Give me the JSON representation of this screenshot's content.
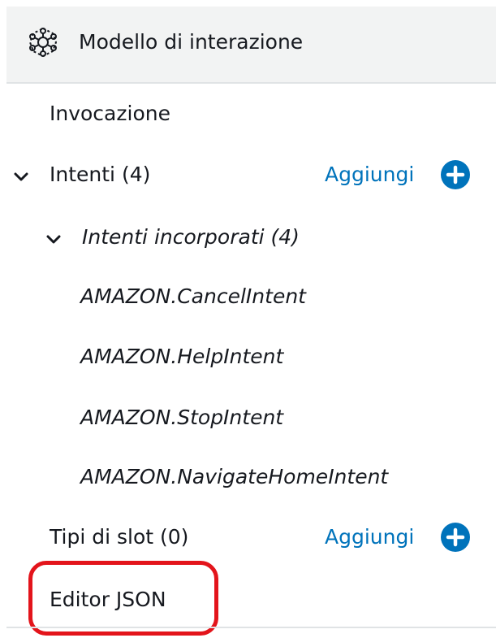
{
  "header": {
    "icon": "interaction-model-icon",
    "title": "Modello di interazione"
  },
  "nav": {
    "invocation": "Invocazione",
    "intents": {
      "label": "Intenti (4)",
      "expanded": true,
      "add_label": "Aggiungi"
    },
    "builtin_intents": {
      "label": "Intenti incorporati (4)",
      "expanded": true,
      "items": [
        "AMAZON.CancelIntent",
        "AMAZON.HelpIntent",
        "AMAZON.StopIntent",
        "AMAZON.NavigateHomeIntent"
      ]
    },
    "slot_types": {
      "label": "Tipi di slot (0)",
      "add_label": "Aggiungi"
    },
    "json_editor": "Editor JSON"
  },
  "colors": {
    "link": "#0073bb",
    "add_button": "#0073bb",
    "highlight": "#e3141b",
    "header_bg": "#f2f3f3"
  }
}
